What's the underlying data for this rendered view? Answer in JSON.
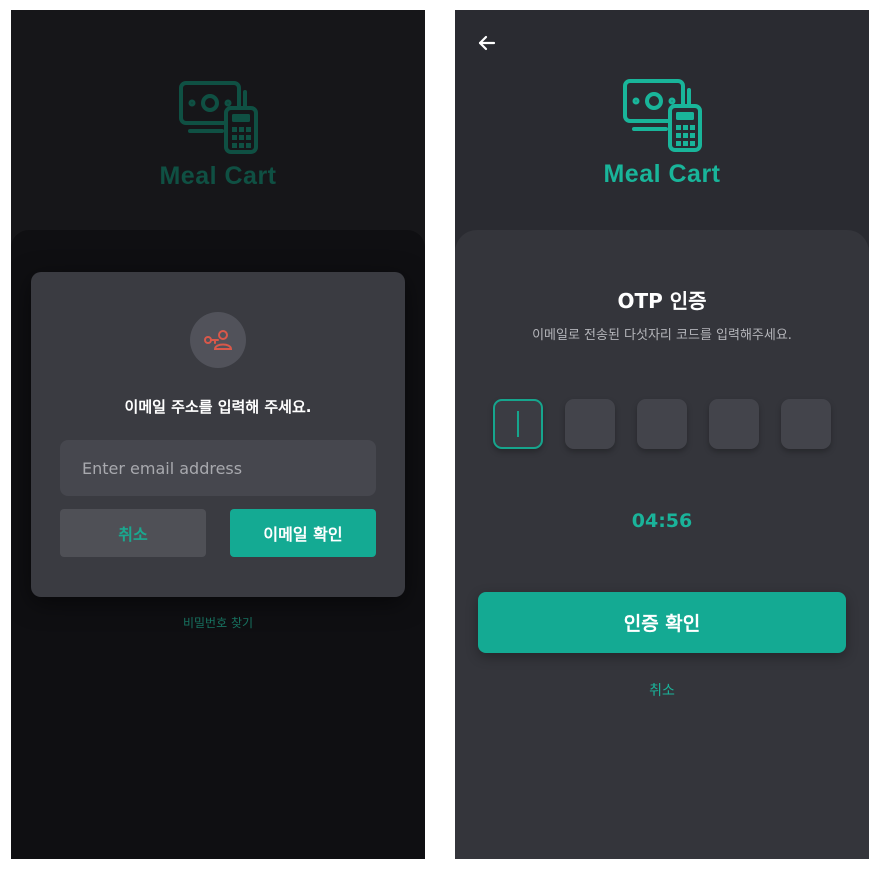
{
  "colors": {
    "accent": "#14aa93",
    "accent_dim": "#16705e",
    "bg_left": "#1f1f23",
    "bg_right": "#2a2b31",
    "modal_bg": "#3a3b41",
    "error_icon": "#d9584a"
  },
  "left_screen": {
    "logo": {
      "icon": "money-calculator-icon",
      "title": "Meal Cart"
    },
    "modal": {
      "icon": "user-key-icon",
      "title": "이메일 주소를 입력해 주세요.",
      "email_input": {
        "placeholder": "Enter email address",
        "value": ""
      },
      "cancel_label": "취소",
      "confirm_label": "이메일 확인"
    },
    "find_password_label": "비밀번호 찾기"
  },
  "right_screen": {
    "back_icon": "arrow-left-icon",
    "logo": {
      "icon": "money-calculator-icon",
      "title": "Meal Cart"
    },
    "otp": {
      "title": "OTP 인증",
      "subtitle": "이메일로 전송된 다섯자리 코드를 입력해주세요.",
      "digits": [
        "",
        "",
        "",
        "",
        ""
      ],
      "active_index": 0
    },
    "timer": "04:56",
    "verify_label": "인증 확인",
    "cancel_label": "취소"
  }
}
